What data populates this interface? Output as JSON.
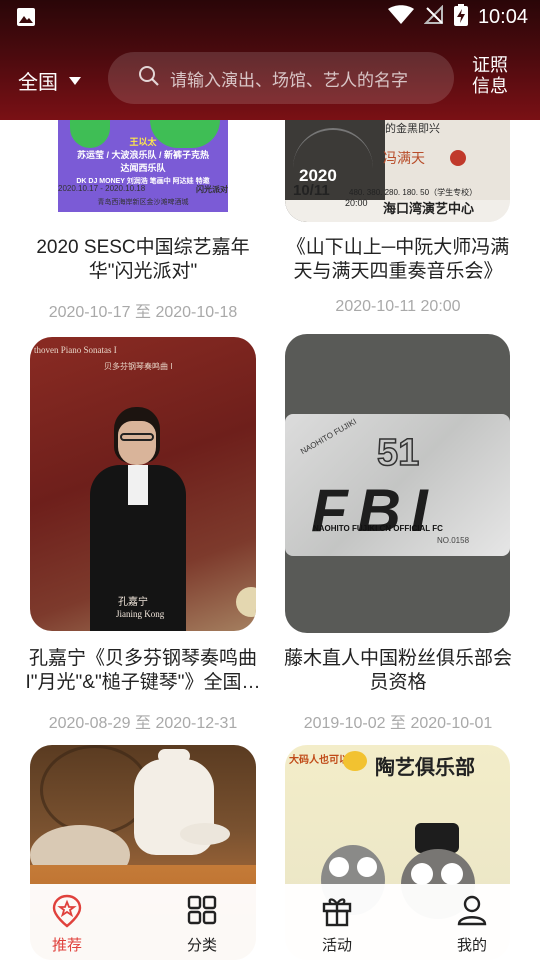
{
  "status": {
    "time": "10:04"
  },
  "header": {
    "city": "全国",
    "search_placeholder": "请输入演出、场馆、艺人的名字",
    "cert_label": "证照信息"
  },
  "events": [
    {
      "title": "2020 SESC中国综艺嘉年华\"闪光派对\"",
      "date": "2020-10-17 至 2020-10-18"
    },
    {
      "title": "《山下山上─中阮大师冯满天与满天四重奏音乐会》",
      "date": "2020-10-11 20:00"
    },
    {
      "title": "孔嘉宁《贝多芬钢琴奏鸣曲I\"月光\"&\"槌子键琴\"》全国巡演",
      "date": "2020-08-29 至 2020-12-31"
    },
    {
      "title": "藤木直人中国粉丝俱乐部会员资格",
      "date": "2019-10-02 至 2020-10-01"
    }
  ],
  "posters": {
    "p1": {
      "lines": [
        "王以太",
        "苏运莹 / 大波浪乐队 / 新裤子克热",
        "达闻西乐队",
        "DK DJ MONEY 刘润浩 笔画中 阿达娃 特邀"
      ],
      "dates": "2020.10.17 - 2020.10.18",
      "venue": "青岛西海岸新区金沙滩啤酒城",
      "brand": "闪光派对"
    },
    "p2": {
      "name": "冯满天",
      "tag": "的金黑即兴",
      "date": "2020",
      "date2": "10/11",
      "time": "20:00",
      "venue": "海口湾演艺中心",
      "prices": "480. 380. 280. 180. 50（学生专校）"
    },
    "p3": {
      "cn": "孔嘉宁",
      "en": "Jianing Kong",
      "sub": "贝多芬钢琴奏鸣曲 I",
      "en_title": "thoven Piano Sonatas I"
    },
    "p4": {
      "text1": "NAOHITO FUJIKI",
      "num": "51",
      "big": "FBI",
      "text2": "NAOHITO FUJIKI CN OFFICIAL FC",
      "serial": "NO.0158"
    },
    "p6": {
      "title": "陶艺俱乐部",
      "sub": "大码人也可以"
    }
  },
  "nav": [
    {
      "label": "推荐",
      "icon": "recommend-icon",
      "active": true
    },
    {
      "label": "分类",
      "icon": "category-icon",
      "active": false
    },
    {
      "label": "活动",
      "icon": "gift-icon",
      "active": false
    },
    {
      "label": "我的",
      "icon": "profile-icon",
      "active": false
    }
  ],
  "colors": {
    "accent": "#e0413c",
    "header_dark": "#2a0608",
    "header_red": "#7a1015"
  }
}
